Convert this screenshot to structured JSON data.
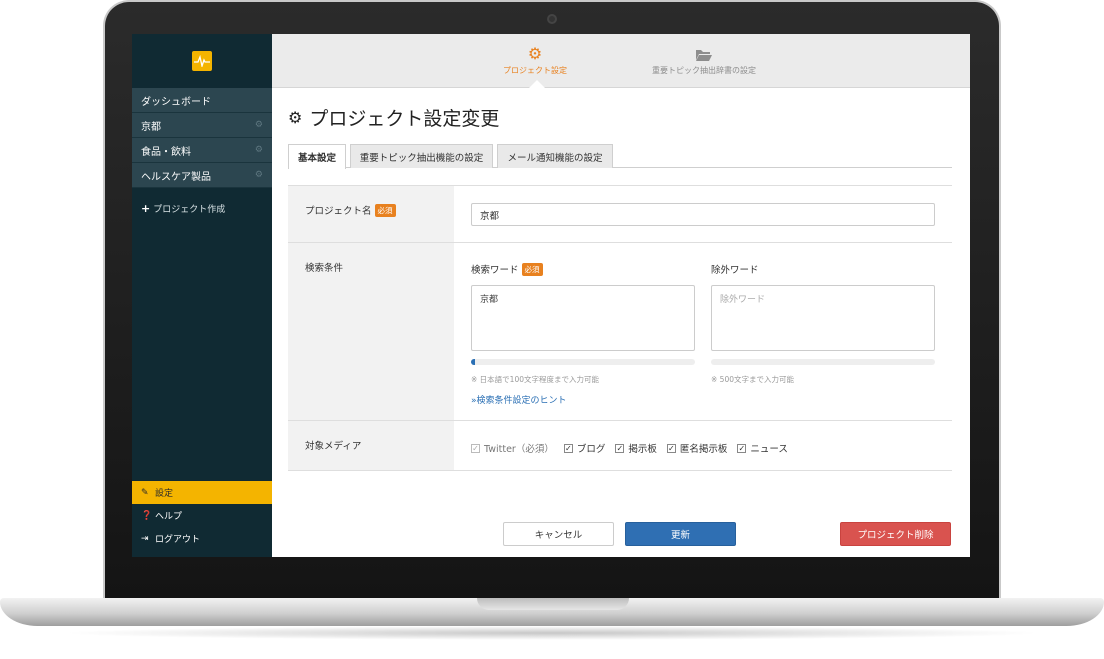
{
  "sidebar": {
    "logo_icon": "pulse-icon",
    "projects": [
      {
        "label": "ダッシュボード",
        "icon": ""
      },
      {
        "label": "京都",
        "icon": "gear-icon"
      },
      {
        "label": "食品・飲料",
        "icon": "gear-icon"
      },
      {
        "label": "ヘルスケア製品",
        "icon": "gear-icon"
      }
    ],
    "create_label": "プロジェクト作成",
    "bottom": [
      {
        "label": "設定",
        "icon": "wrench-icon",
        "active": true
      },
      {
        "label": "ヘルプ",
        "icon": "help-icon",
        "active": false
      },
      {
        "label": "ログアウト",
        "icon": "logout-icon",
        "active": false
      }
    ]
  },
  "steps": [
    {
      "label": "プロジェクト設定",
      "icon": "gears-icon",
      "active": true
    },
    {
      "label": "重要トピック抽出辞書の設定",
      "icon": "folder-open-icon",
      "active": false
    }
  ],
  "page": {
    "title": "プロジェクト設定変更",
    "tabs": [
      {
        "label": "基本設定",
        "active": true
      },
      {
        "label": "重要トピック抽出機能の設定",
        "active": false
      },
      {
        "label": "メール通知機能の設定",
        "active": false
      }
    ]
  },
  "form": {
    "required_badge": "必須",
    "project_name": {
      "label": "プロジェクト名",
      "value": "京都"
    },
    "search": {
      "label": "検索条件",
      "keywords_label": "検索ワード",
      "keywords_value": "京都",
      "keywords_note": "※ 日本語で100文字程度まで入力可能",
      "keywords_progress": 0.02,
      "exclude_label": "除外ワード",
      "exclude_placeholder": "除外ワード",
      "exclude_note": "※ 500文字まで入力可能",
      "exclude_progress": 0,
      "hint_link": "»検索条件設定のヒント"
    },
    "media": {
      "label": "対象メディア",
      "options": [
        {
          "label": "Twitter（必須）",
          "checked": true,
          "disabled": true
        },
        {
          "label": "ブログ",
          "checked": true,
          "disabled": false
        },
        {
          "label": "掲示板",
          "checked": true,
          "disabled": false
        },
        {
          "label": "匿名掲示板",
          "checked": true,
          "disabled": false
        },
        {
          "label": "ニュース",
          "checked": true,
          "disabled": false
        }
      ]
    }
  },
  "actions": {
    "cancel": "キャンセル",
    "update": "更新",
    "delete": "プロジェクト削除"
  },
  "colors": {
    "sidebar_bg": "#102a33",
    "accent_orange": "#e8811f",
    "active_yellow": "#f4b400",
    "primary_blue": "#2f6fb3",
    "danger_red": "#d9534f"
  }
}
